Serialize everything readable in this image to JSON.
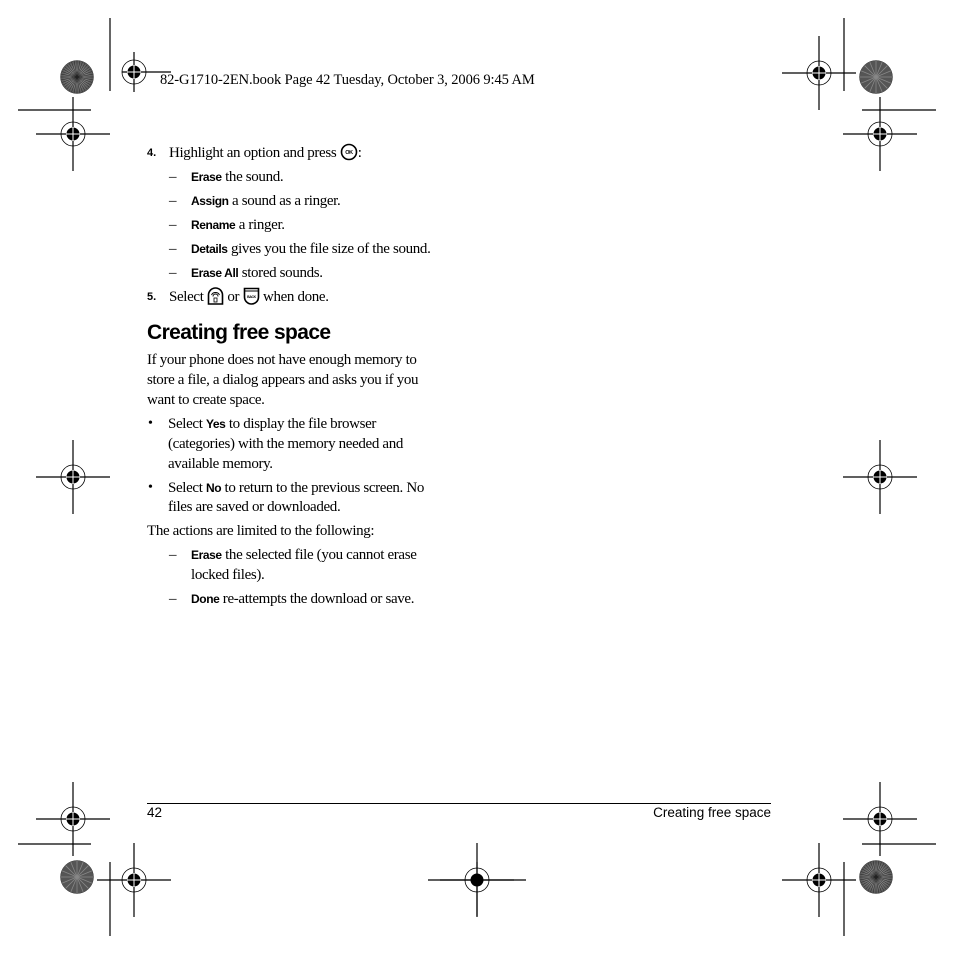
{
  "slug": {
    "text": "82-G1710-2EN.book  Page 42  Tuesday, October 3, 2006  9:45 AM"
  },
  "step4": {
    "number": "4.",
    "text_before_icon": "Highlight an option and press",
    "icon": "ok-key-icon",
    "text_after_icon": ":",
    "options": [
      {
        "keyword": "Erase",
        "text": " the sound."
      },
      {
        "keyword": "Assign",
        "text": " a sound as a ringer."
      },
      {
        "keyword": "Rename",
        "text": " a ringer."
      },
      {
        "keyword": "Details",
        "text": " gives you the file size of the sound."
      },
      {
        "keyword": "Erase All",
        "text": " stored sounds."
      }
    ],
    "dash": "–"
  },
  "step5": {
    "number": "5.",
    "text_select": "Select",
    "icon1": "home-key-icon",
    "text_or": "or",
    "icon2": "back-key-icon",
    "text_done": "when done."
  },
  "section": {
    "heading": "Creating free space",
    "intro_lines": [
      "If your phone does not have enough memory to",
      "store a file, a dialog appears and asks you if you",
      "want to create space."
    ],
    "bullets": [
      {
        "prefix": "Select ",
        "keyword": "Yes",
        "lines": [
          " to display the file browser",
          "(categories) with the memory needed and",
          "available memory."
        ]
      },
      {
        "prefix": "Select ",
        "keyword": "No",
        "lines": [
          " to return to the previous screen. No",
          "files are saved or downloaded."
        ]
      }
    ],
    "bullet_glyph": "•",
    "actions_intro": "The actions are limited to the following:",
    "actions": [
      {
        "keyword": "Erase",
        "lines": [
          " the selected file (you cannot erase",
          "locked files)."
        ]
      },
      {
        "keyword": "Done",
        "lines": [
          " re-attempts the download or save."
        ]
      }
    ]
  },
  "footer": {
    "page_number": "42",
    "running_title": "Creating free space"
  },
  "print_marks": {
    "registration_mark": "registration-target-icon",
    "color_bar": "starburst-color-target-icon"
  }
}
